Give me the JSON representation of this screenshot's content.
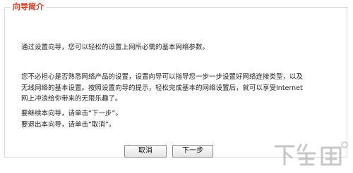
{
  "wizard": {
    "legend": "向导简介",
    "paragraph1": [
      "通过设置向导，您可以轻松的设置上网所必需的基本网络参数。"
    ],
    "paragraph2": [
      "您不必担心是否熟悉网络产品的设置，设置向导可以指导您一步一步设置好网络连接类型，以及",
      "无线网络的基本设置。按照设置向导的提示，轻松完成基本的网络设置后，就可以享受Internet",
      "网上冲浪给你带来的无限乐趣了。"
    ],
    "paragraph3": [
      "要继续本向导，请单击“下一步”。",
      "要退出本向导，请单击“取消”。"
    ]
  },
  "buttons": {
    "cancel": "取消",
    "next": "下一步"
  },
  "watermark": {
    "text": "下载吧"
  }
}
